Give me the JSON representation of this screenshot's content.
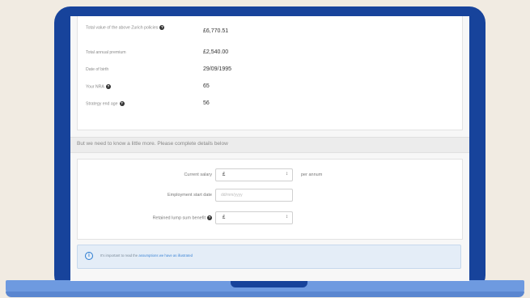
{
  "summary": {
    "rows": [
      {
        "label": "Total value of the above Zurich policies",
        "value": "£6,770.51",
        "help": true
      },
      {
        "label": "Total annual premium",
        "value": "£2,540.00",
        "help": false
      },
      {
        "label": "Date of birth",
        "value": "29/09/1995",
        "help": false
      },
      {
        "label": "Your NRA",
        "value": "65",
        "help": true
      },
      {
        "label": "Strategy end age",
        "value": "56",
        "help": true
      }
    ]
  },
  "band": {
    "text": "But we need to know a little more. Please complete details below"
  },
  "form": {
    "salary": {
      "label": "Current salary",
      "value": "£",
      "per": "per annum"
    },
    "employment": {
      "label": "Employment start date",
      "placeholder": "dd/mm/yyyy"
    },
    "lump_sum": {
      "label": "Retained lump sum benefit",
      "value": "£"
    }
  },
  "info": {
    "text": "It's important to read the ",
    "link": "assumptions we have as illustrated"
  },
  "colors": {
    "frame": "#17439b",
    "base": "#6e9ae0",
    "background": "#f1ebe2",
    "accent": "#2a7bd1"
  }
}
